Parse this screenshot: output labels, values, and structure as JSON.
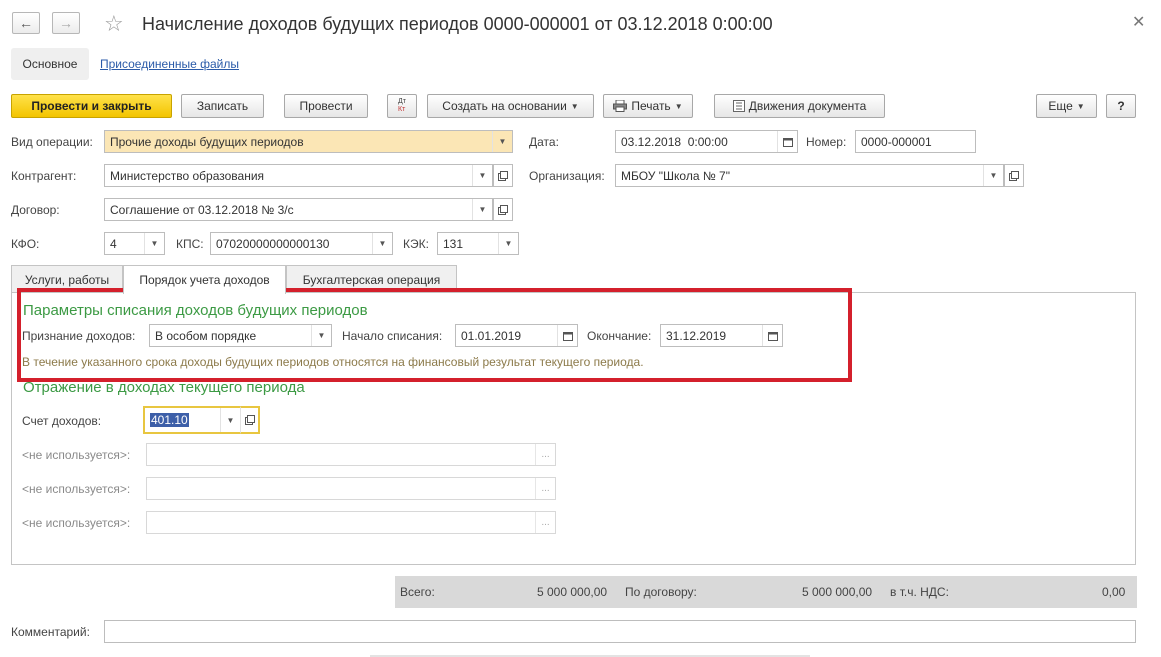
{
  "window": {
    "title": "Начисление доходов будущих периодов 0000-000001 от 03.12.2018 0:00:00"
  },
  "nav_tabs": {
    "main": "Основное",
    "files": "Присоединенные файлы"
  },
  "toolbar": {
    "post_close": "Провести и закрыть",
    "save": "Записать",
    "post": "Провести",
    "dt_kt_top": "Дт",
    "dt_kt_bottom": "Кт",
    "create_based": "Создать на основании",
    "print": "Печать",
    "movements": "Движения документа",
    "more": "Еще",
    "help": "?"
  },
  "header": {
    "op_type_label": "Вид операции:",
    "op_type_value": "Прочие доходы будущих периодов",
    "date_label": "Дата:",
    "date_value": "03.12.2018  0:00:00",
    "number_label": "Номер:",
    "number_value": "0000-000001",
    "counterparty_label": "Контрагент:",
    "counterparty_value": "Министерство образования",
    "org_label": "Организация:",
    "org_value": "МБОУ \"Школа № 7\"",
    "contract_label": "Договор:",
    "contract_value": "Соглашение от 03.12.2018 № 3/с",
    "kfo_label": "КФО:",
    "kfo_value": "4",
    "kps_label": "КПС:",
    "kps_value": "07020000000000130",
    "kek_label": "КЭК:",
    "kek_value": "131"
  },
  "tabs": [
    {
      "label": "Услуги, работы"
    },
    {
      "label": "Порядок учета доходов"
    },
    {
      "label": "Бухгалтерская операция"
    }
  ],
  "writeoff": {
    "title": "Параметры списания доходов будущих периодов",
    "recognition_label": "Признание доходов:",
    "recognition_value": "В особом порядке",
    "start_label": "Начало списания:",
    "start_value": "01.01.2019",
    "end_label": "Окончание:",
    "end_value": "31.12.2019",
    "hint": "В течение указанного срока доходы будущих периодов относятся на финансовый результат текущего периода."
  },
  "current_income": {
    "title": "Отражение в доходах текущего периода",
    "account_label": "Счет доходов:",
    "account_value": "401.10",
    "unused_label": "<не используется>:"
  },
  "totals": {
    "total_label": "Всего:",
    "total_value": "5 000 000,00",
    "contract_label": "По договору:",
    "contract_value": "5 000 000,00",
    "vat_label": "в т.ч. НДС:",
    "vat_value": "0,00"
  },
  "comment": {
    "label": "Комментарий:",
    "value": ""
  },
  "colors": {
    "accent_yellow": "#f3c400",
    "highlight_field": "#fbe6b5",
    "section_green": "#3c9a44",
    "annotation_red": "#d4202c"
  }
}
